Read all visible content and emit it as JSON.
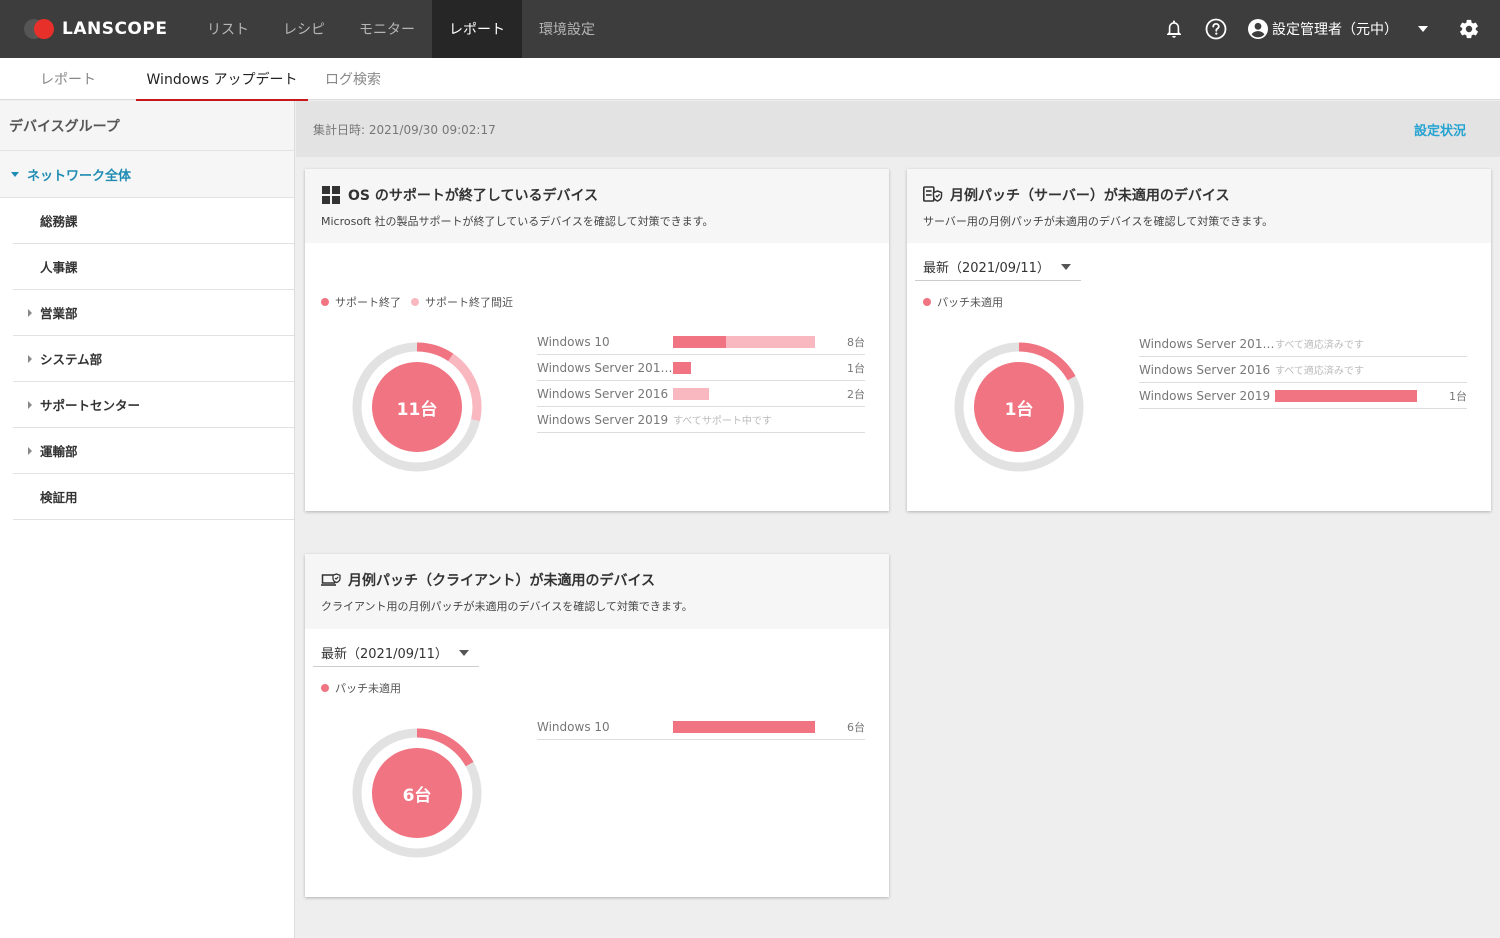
{
  "brand": {
    "name": "LANSCOPE"
  },
  "topnav": {
    "items": [
      {
        "label": "リスト"
      },
      {
        "label": "レシピ"
      },
      {
        "label": "モニター"
      },
      {
        "label": "レポート"
      },
      {
        "label": "環境設定"
      }
    ],
    "active_index": 3,
    "user_name": "設定管理者（元中）"
  },
  "subnav": {
    "tabs": [
      {
        "label": "レポート"
      },
      {
        "label": "Windows アップデート"
      },
      {
        "label": "ログ検索"
      }
    ],
    "active_index": 1
  },
  "sidebar": {
    "heading": "デバイスグループ",
    "root": "ネットワーク全体",
    "items": [
      {
        "label": "総務課",
        "expandable": false
      },
      {
        "label": "人事課",
        "expandable": false
      },
      {
        "label": "営業部",
        "expandable": true
      },
      {
        "label": "システム部",
        "expandable": true
      },
      {
        "label": "サポートセンター",
        "expandable": true
      },
      {
        "label": "運輸部",
        "expandable": true
      },
      {
        "label": "検証用",
        "expandable": false
      }
    ]
  },
  "infobar": {
    "stamp": "集計日時: 2021/09/30 09:02:17",
    "link": "設定状況"
  },
  "colors": {
    "primary": "#f07482",
    "light": "#f9b8bf",
    "ring_bg": "#e2e2e2",
    "link": "#25a3d1",
    "tab_underline": "#c8161d"
  },
  "cards": {
    "os": {
      "icon": "windows-icon",
      "title": "OS のサポートが終了しているデバイス",
      "desc": "Microsoft 社の製品サポートが終了しているデバイスを確認して対策できます。",
      "legend": [
        "サポート終了",
        "サポート終了間近"
      ],
      "center_label": "11台",
      "ring": [
        {
          "series": "サポート終了",
          "fraction": 0.095
        },
        {
          "series": "サポート終了間近",
          "fraction": 0.19
        }
      ],
      "rows": [
        {
          "name": "Windows 10",
          "count": "8台",
          "segments": [
            {
              "series": 0,
              "value": 3
            },
            {
              "series": 1,
              "value": 5
            }
          ],
          "note": ""
        },
        {
          "name": "Windows Server 2012...",
          "count": "1台",
          "segments": [
            {
              "series": 0,
              "value": 1
            }
          ],
          "note": ""
        },
        {
          "name": "Windows Server 2016",
          "count": "2台",
          "segments": [
            {
              "series": 1,
              "value": 2
            }
          ],
          "note": ""
        },
        {
          "name": "Windows Server 2019",
          "count": "",
          "segments": [],
          "note": "すべてサポート中です"
        }
      ],
      "bar_max": 8
    },
    "server": {
      "icon": "server-patch-icon",
      "title": "月例パッチ（サーバー）が未適用のデバイス",
      "desc": "サーバー用の月例パッチが未適用のデバイスを確認して対策できます。",
      "select": "最新（2021/09/11）",
      "legend": [
        "パッチ未適用"
      ],
      "center_label": "1台",
      "ring": [
        {
          "series": "パッチ未適用",
          "fraction": 0.17
        }
      ],
      "rows": [
        {
          "name": "Windows Server 2012...",
          "count": "",
          "segments": [],
          "note": "すべて適応済みです"
        },
        {
          "name": "Windows Server 2016",
          "count": "",
          "segments": [],
          "note": "すべて適応済みです"
        },
        {
          "name": "Windows Server 2019",
          "count": "1台",
          "segments": [
            {
              "series": 0,
              "value": 1
            }
          ],
          "note": ""
        }
      ],
      "bar_max": 1
    },
    "client": {
      "icon": "client-patch-icon",
      "title": "月例パッチ（クライアント）が未適用のデバイス",
      "desc": "クライアント用の月例パッチが未適用のデバイスを確認して対策できます。",
      "select": "最新（2021/09/11）",
      "legend": [
        "パッチ未適用"
      ],
      "center_label": "6台",
      "ring": [
        {
          "series": "パッチ未適用",
          "fraction": 0.17
        }
      ],
      "rows": [
        {
          "name": "Windows 10",
          "count": "6台",
          "segments": [
            {
              "series": 0,
              "value": 6
            }
          ],
          "note": ""
        }
      ],
      "bar_max": 6
    }
  }
}
